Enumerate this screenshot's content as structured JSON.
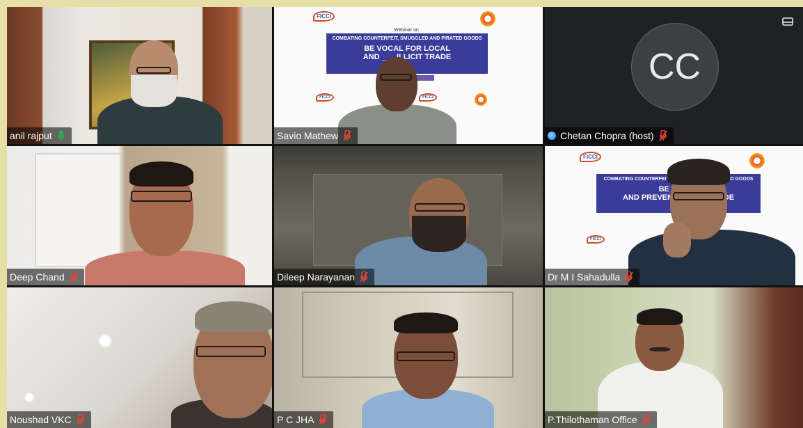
{
  "participants": [
    {
      "name": "anil rajput",
      "mic": "on"
    },
    {
      "name": "Savio Mathew",
      "mic": "muted"
    },
    {
      "name": "Chetan Chopra (host)",
      "mic": "muted",
      "initials": "CC",
      "is_host": true
    },
    {
      "name": "Deep Chand",
      "mic": "muted"
    },
    {
      "name": "Dileep Narayanan",
      "mic": "muted"
    },
    {
      "name": "Dr M I Sahadulla",
      "mic": "muted"
    },
    {
      "name": "Noushad VKC",
      "mic": "muted"
    },
    {
      "name": "P C JHA",
      "mic": "muted"
    },
    {
      "name": "P.Thilothaman Office",
      "mic": "muted"
    }
  ],
  "slide": {
    "logo_text": "FICCI",
    "small_heading": "Webinar on",
    "headline": "COMBATING COUNTERFEIT, SMUGGLED AND PIRATED GOODS",
    "line2": "BE VOCAL FOR LOCAL",
    "line3": "AND PREVENT ILLICIT TRADE",
    "line2_partial": "BE VOCAL FOR LOCAL",
    "line3_partial": "AND ___ ILLICIT TRADE"
  },
  "slide_b": {
    "headline": "COMBATING COUNTERFEIT, SMUGGLED AND PIRATED GOODS",
    "line2": "BE VOCAL",
    "line3": "AND PREVENT ILLICIT TRADE"
  },
  "icons": {
    "mic_on": "mic-icon",
    "mic_muted": "mic-off-icon",
    "layout": "layout-icon",
    "host": "host-badge-icon"
  },
  "colors": {
    "page_background": "#e6dfa8",
    "active_speaker": "#3aa4d8",
    "mic_on": "#34a853",
    "mic_off": "#ea4335",
    "slide_banner": "#3b3b9a"
  }
}
